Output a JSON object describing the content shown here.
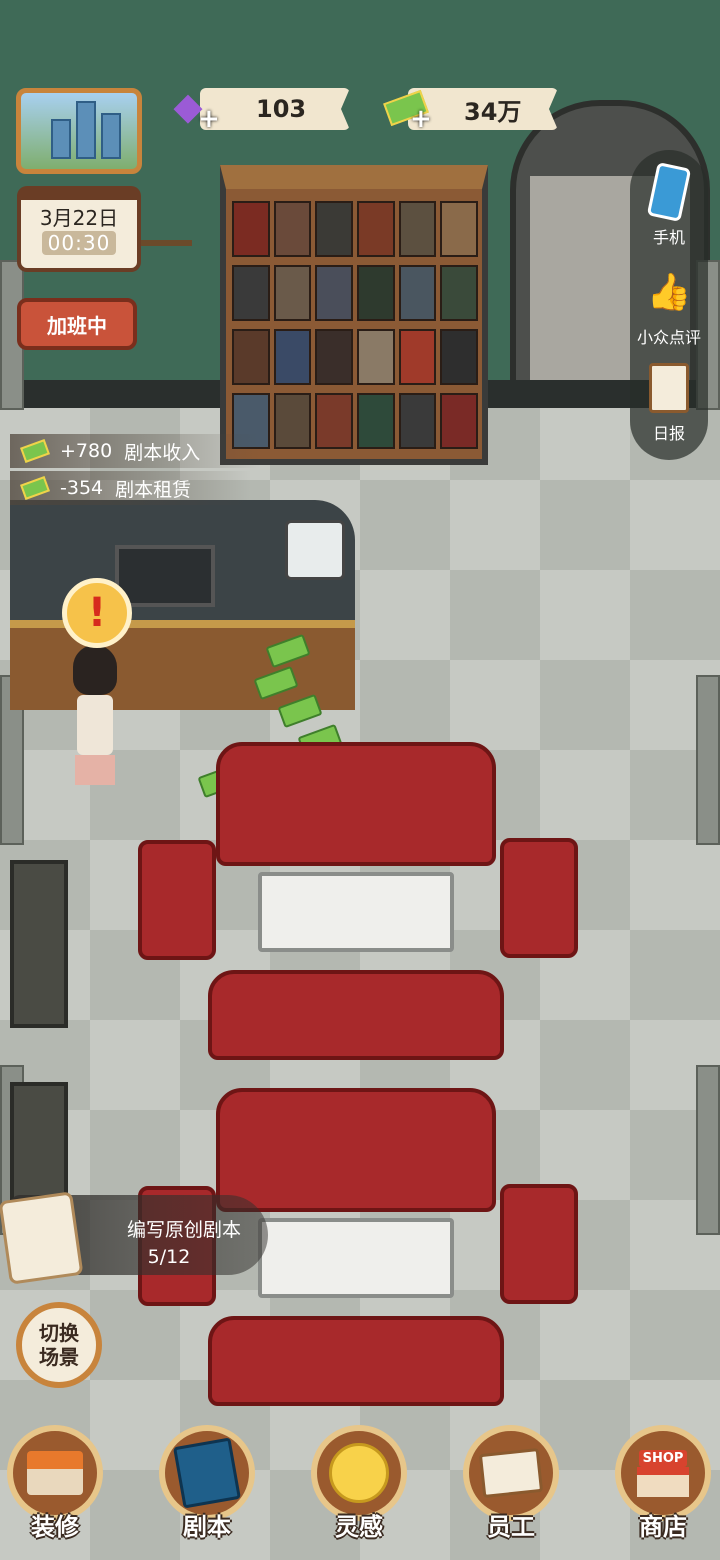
{
  "resources": {
    "gems": {
      "value": "103",
      "icon": "gem-icon",
      "color": "#9b5bd6"
    },
    "cash": {
      "value": "34万",
      "icon": "cash-icon",
      "color": "#7ac54d"
    },
    "plus": "+"
  },
  "calendar": {
    "date": "3月22日",
    "time": "00:30"
  },
  "status_button": "加班中",
  "income_log": [
    {
      "amount": "+780",
      "label": "剧本收入"
    },
    {
      "amount": "-354",
      "label": "剧本租赁"
    }
  ],
  "side_menu": [
    {
      "label": "手机",
      "icon": "phone-icon"
    },
    {
      "label": "小众点评",
      "icon": "thumbs-up-icon"
    },
    {
      "label": "日报",
      "icon": "clipboard-icon"
    }
  ],
  "quest": {
    "title": "编写原创剧本",
    "progress": "5/12"
  },
  "switch_scene": {
    "line1": "切换",
    "line2": "场景"
  },
  "alert_glyph": "!",
  "bottom_nav": [
    {
      "label": "装修",
      "icon": "house-icon"
    },
    {
      "label": "剧本",
      "icon": "script-book-icon"
    },
    {
      "label": "灵感",
      "icon": "lightbulb-icon"
    },
    {
      "label": "员工",
      "icon": "staff-badge-icon"
    },
    {
      "label": "商店",
      "icon": "shop-icon",
      "sign": "SHOP"
    }
  ]
}
